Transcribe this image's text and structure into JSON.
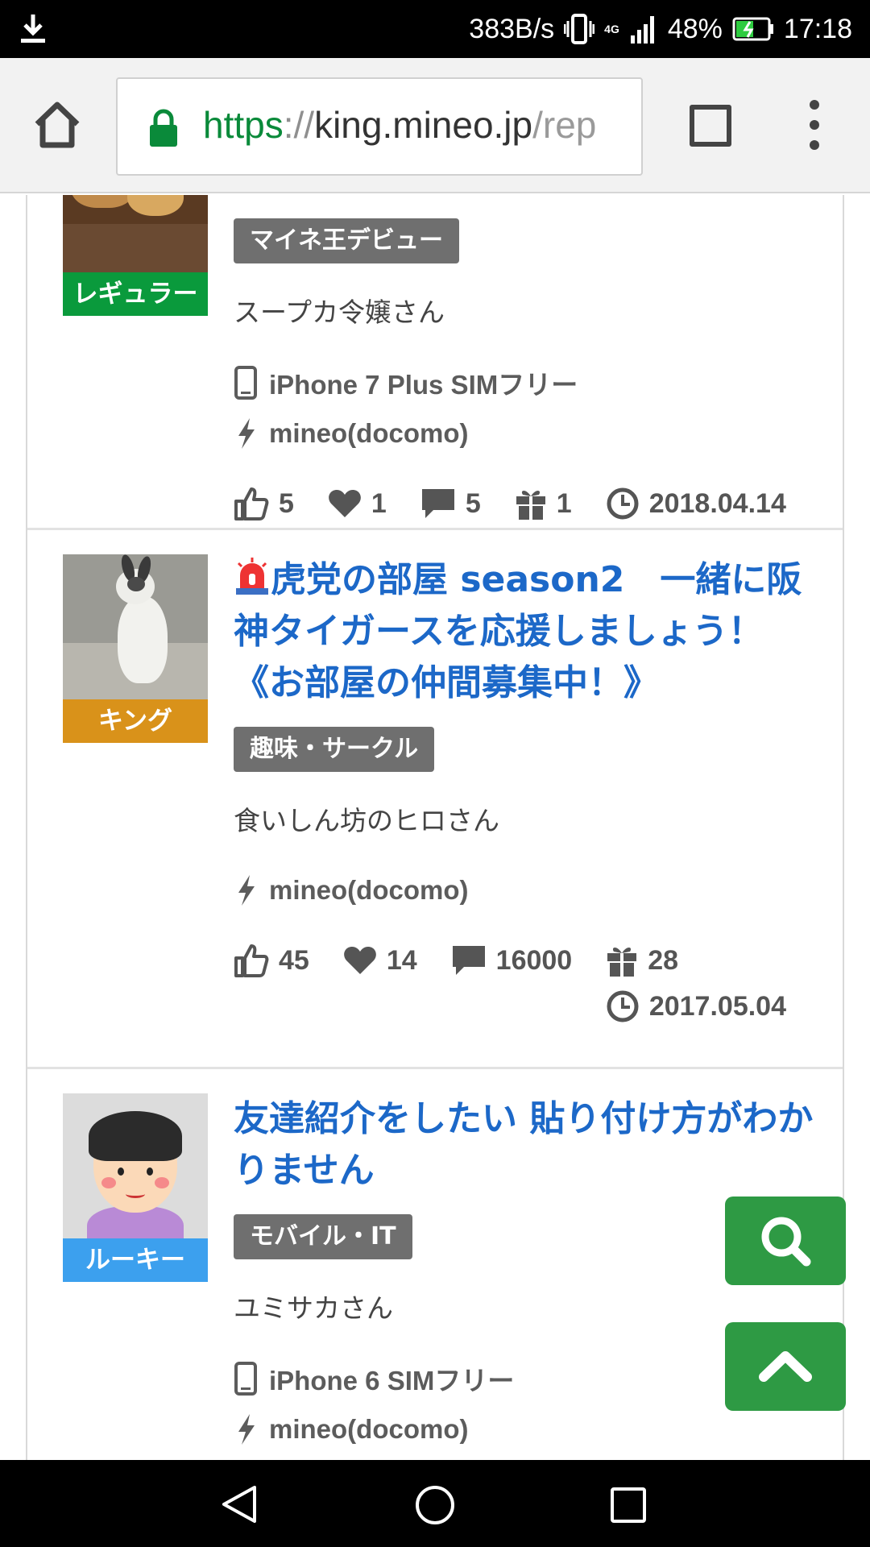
{
  "status_bar": {
    "net_speed": "383B/s",
    "network": "4G",
    "battery": "48%",
    "time": "17:18"
  },
  "browser": {
    "url_scheme": "https",
    "url_sep": "://",
    "url_host": "king.mineo.jp",
    "url_path": "/rep"
  },
  "posts": [
    {
      "rank": "レギュラー",
      "rank_color": "#0a9a3c",
      "tag": "マイネ王デビュー",
      "author": "スープカ令嬢さん",
      "device": "iPhone 7 Plus SIMフリー",
      "carrier": "mineo(docomo)",
      "likes": "5",
      "hearts": "1",
      "comments": "5",
      "gifts": "1",
      "date": "2018.04.14"
    },
    {
      "rank": "キング",
      "rank_color": "#d9921a",
      "title": "虎党の部屋 season2　一緒に阪神タイガースを応援しましょう！《お部屋の仲間募集中！》",
      "tag": "趣味・サークル",
      "author": "食いしん坊のヒロさん",
      "carrier": "mineo(docomo)",
      "likes": "45",
      "hearts": "14",
      "comments": "16000",
      "gifts": "28",
      "date": "2017.05.04"
    },
    {
      "rank": "ルーキー",
      "rank_color": "#3ca0ee",
      "title": "友達紹介をしたい 貼り付け方がわかりません",
      "tag": "モバイル・IT",
      "author": "ユミサカさん",
      "device": "iPhone 6 SIMフリー",
      "carrier": "mineo(docomo)"
    }
  ],
  "colors": {
    "title_blue": "#1c68c8",
    "fab_green": "#2e9a44",
    "tag_gray": "#6f6f6f"
  }
}
